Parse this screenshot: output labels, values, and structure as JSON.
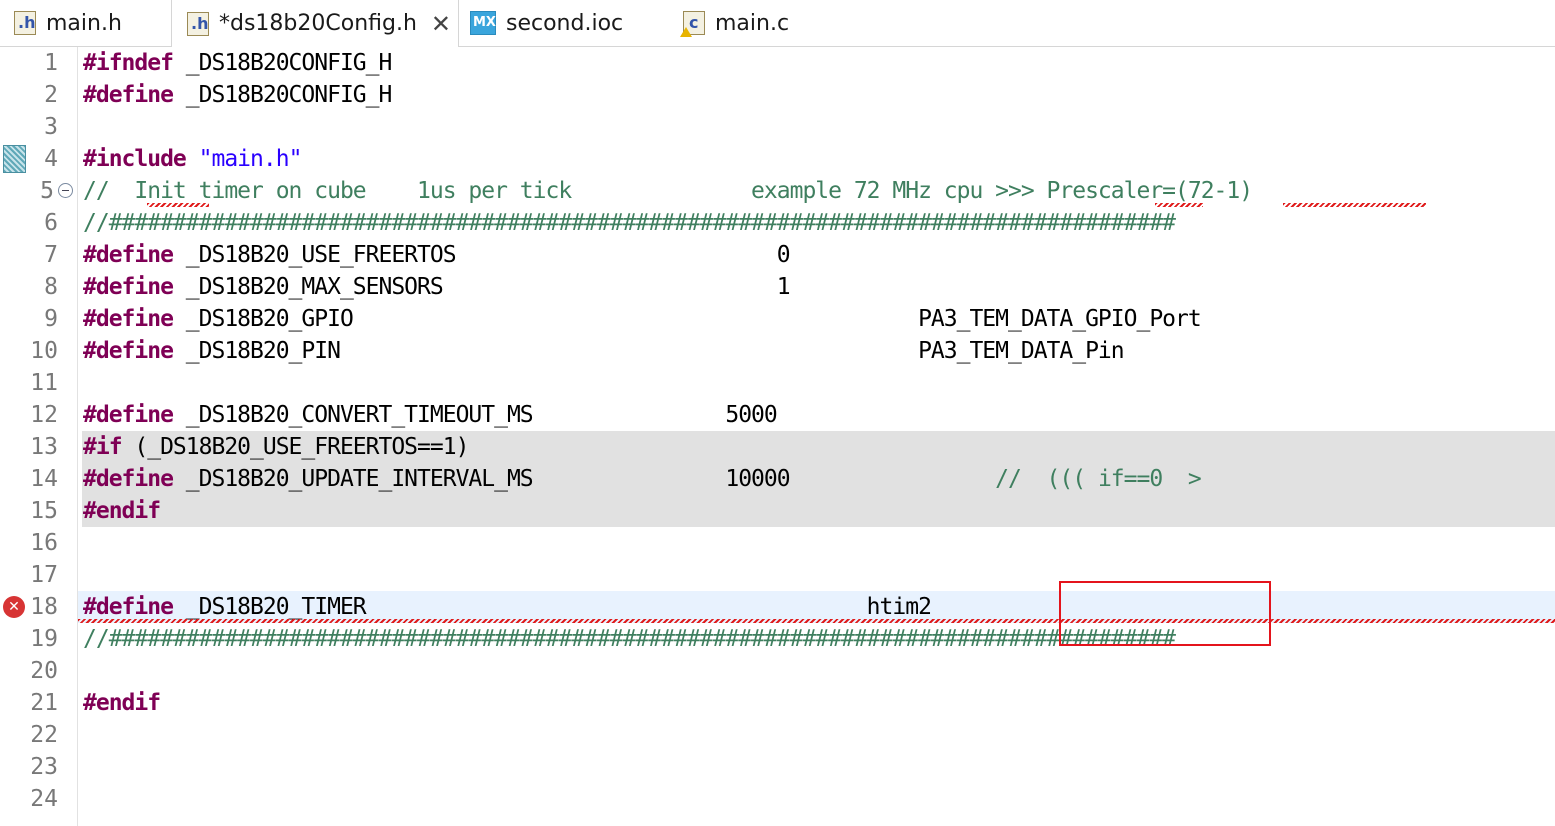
{
  "tabs": [
    {
      "label": "main.h",
      "icon": "h-file-icon",
      "active": false
    },
    {
      "label": "*ds18b20Config.h",
      "icon": "h-file-icon",
      "active": true
    },
    {
      "label": "second.ioc",
      "icon": "mx-file-icon",
      "active": false
    },
    {
      "label": "main.c",
      "icon": "c-file-icon",
      "active": false
    }
  ],
  "icon_glyphs": {
    "h": ".h",
    "mx": "MX",
    "c": "c",
    "close": "✕",
    "error": "✕"
  },
  "lines": [
    {
      "num": "1",
      "kw": "#ifndef",
      "rest": " _DS18B20CONFIG_H"
    },
    {
      "num": "2",
      "kw": "#define",
      "rest": " _DS18B20CONFIG_H"
    },
    {
      "num": "3"
    },
    {
      "num": "4",
      "kw": "#include",
      "rest": " ",
      "str": "\"main.h\""
    },
    {
      "num": "5",
      "comment": "//  Init timer on cube    1us per tick              example 72 MHz cpu >>> Prescaler=(72-1)"
    },
    {
      "num": "6",
      "comment": "//###################################################################################"
    },
    {
      "num": "7",
      "kw": "#define",
      "rest": " _DS18B20_USE_FREERTOS                         0"
    },
    {
      "num": "8",
      "kw": "#define",
      "rest": " _DS18B20_MAX_SENSORS                          1"
    },
    {
      "num": "9",
      "kw": "#define",
      "rest": " _DS18B20_GPIO                                            PA3_TEM_DATA_GPIO_Port"
    },
    {
      "num": "10",
      "kw": "#define",
      "rest": " _DS18B20_PIN                                             PA3_TEM_DATA_Pin"
    },
    {
      "num": "11"
    },
    {
      "num": "12",
      "kw": "#define",
      "rest": " _DS18B20_CONVERT_TIMEOUT_MS               5000"
    },
    {
      "num": "13",
      "kw": "#if",
      "rest": " (_DS18B20_USE_FREERTOS==1)"
    },
    {
      "num": "14",
      "kw": "#define",
      "rest": " _DS18B20_UPDATE_INTERVAL_MS               10000",
      "comment": "                //  ((( if==0  >"
    },
    {
      "num": "15",
      "kw": "#endif"
    },
    {
      "num": "16"
    },
    {
      "num": "17"
    },
    {
      "num": "18",
      "kw": "#define",
      "rest": " _DS18B20_TIMER                                       htim2"
    },
    {
      "num": "19",
      "comment": "//###################################################################################"
    },
    {
      "num": "20"
    },
    {
      "num": "21",
      "kw": "#endif"
    },
    {
      "num": "22"
    },
    {
      "num": "23"
    },
    {
      "num": "24"
    }
  ],
  "colors": {
    "keyword": "#7f0055",
    "string": "#2a00ff",
    "comment": "#3f7f5f",
    "line_number": "#787878",
    "inactive_block": "#e1e1e1",
    "current_line": "#e8f2fe",
    "highlight_box": "#e4141c"
  }
}
